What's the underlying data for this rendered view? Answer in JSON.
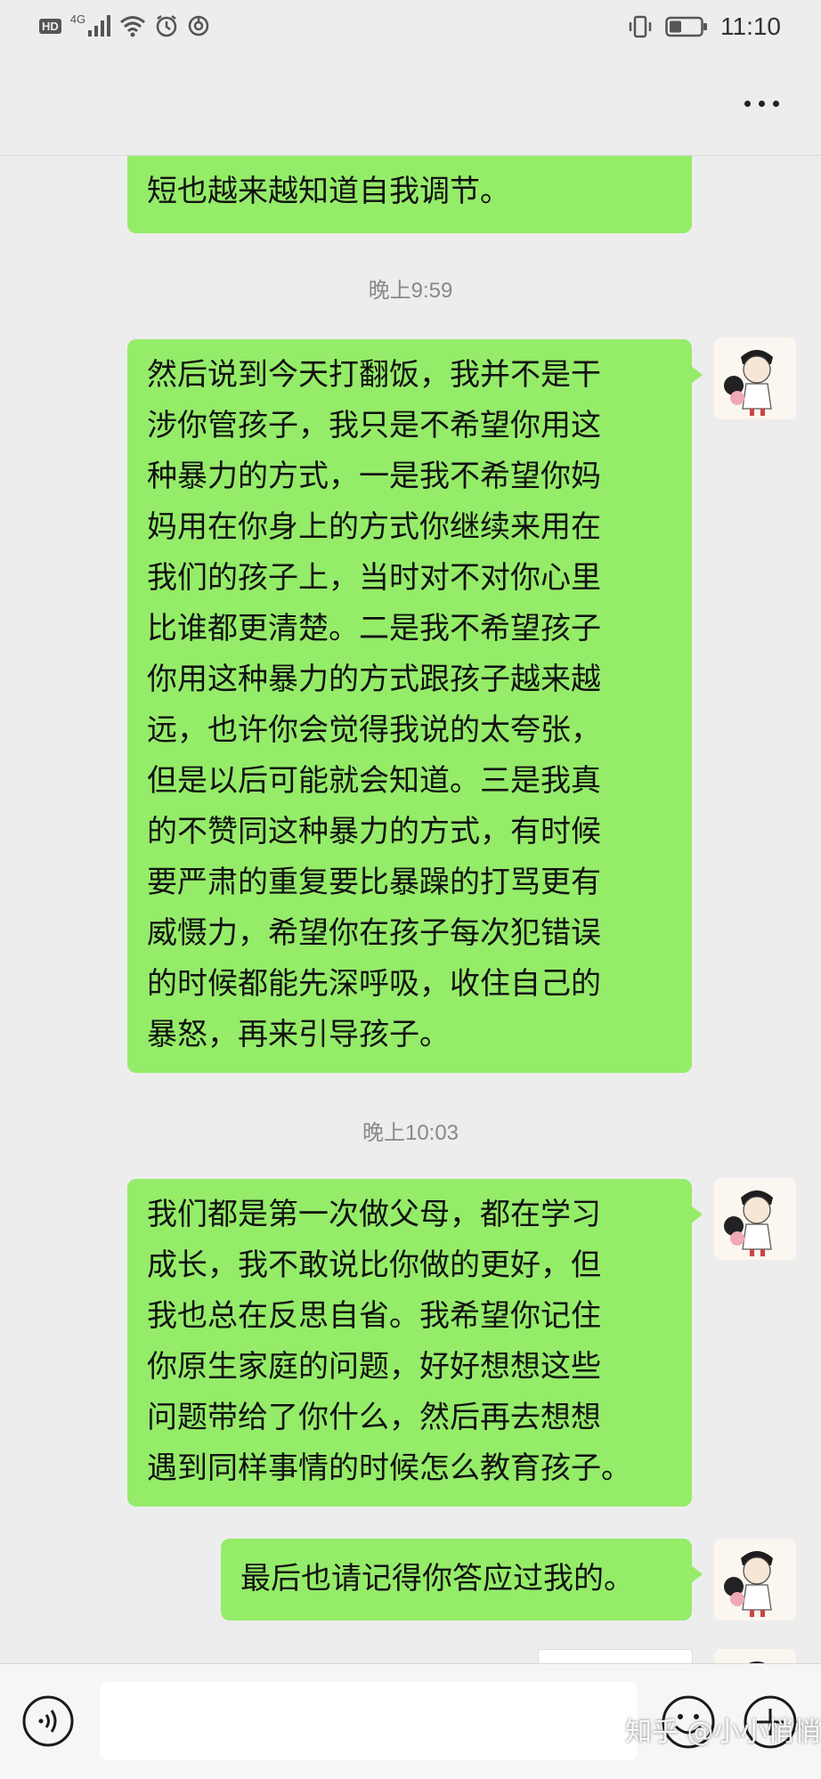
{
  "status_bar": {
    "hd": "HD",
    "network": "4G",
    "time": "11:10",
    "icons": [
      "signal-icon",
      "wifi-icon",
      "alarm-icon",
      "sync-icon",
      "vibrate-icon",
      "battery-icon"
    ]
  },
  "nav": {
    "more_icon": "more-dots-icon"
  },
  "chat": {
    "messages": [
      {
        "lines": [
          "短也越来越知道自我调节。"
        ]
      },
      {
        "timestamp": "晚上9:59"
      },
      {
        "lines": [
          "然后说到今天打翻饭，我并不是干",
          "涉你管孩子，我只是不希望你用这",
          "种暴力的方式，一是我不希望你妈",
          "妈用在你身上的方式你继续来用在",
          "我们的孩子上，当时对不对你心里",
          "比谁都更清楚。二是我不希望孩子",
          "你用这种暴力的方式跟孩子越来越",
          "远，也许你会觉得我说的太夸张，",
          "但是以后可能就会知道。三是我真",
          "的不赞同这种暴力的方式，有时候",
          "要严肃的重复要比暴躁的打骂更有",
          "威慑力，希望你在孩子每次犯错误",
          "的时候都能先深呼吸，收住自己的",
          "暴怒，再来引导孩子。"
        ]
      },
      {
        "timestamp": "晚上10:03"
      },
      {
        "lines": [
          "我们都是第一次做父母，都在学习",
          "成长，我不敢说比你做的更好，但",
          "我也总在反思自省。我希望你记住",
          "你原生家庭的问题，好好想想这些",
          "问题带给了你什么，然后再去想想",
          "遇到同样事情的时候怎么教育孩子。"
        ]
      },
      {
        "lines": [
          "最后也请记得你答应过我的。"
        ]
      }
    ]
  },
  "input_bar": {
    "voice_icon": "voice-icon",
    "emoji_icon": "emoji-icon",
    "plus_icon": "plus-icon"
  },
  "watermark": "知乎 @小小悄悄",
  "colors": {
    "bubble": "#95ec69",
    "background": "#ededed",
    "timestamp": "#888888"
  }
}
